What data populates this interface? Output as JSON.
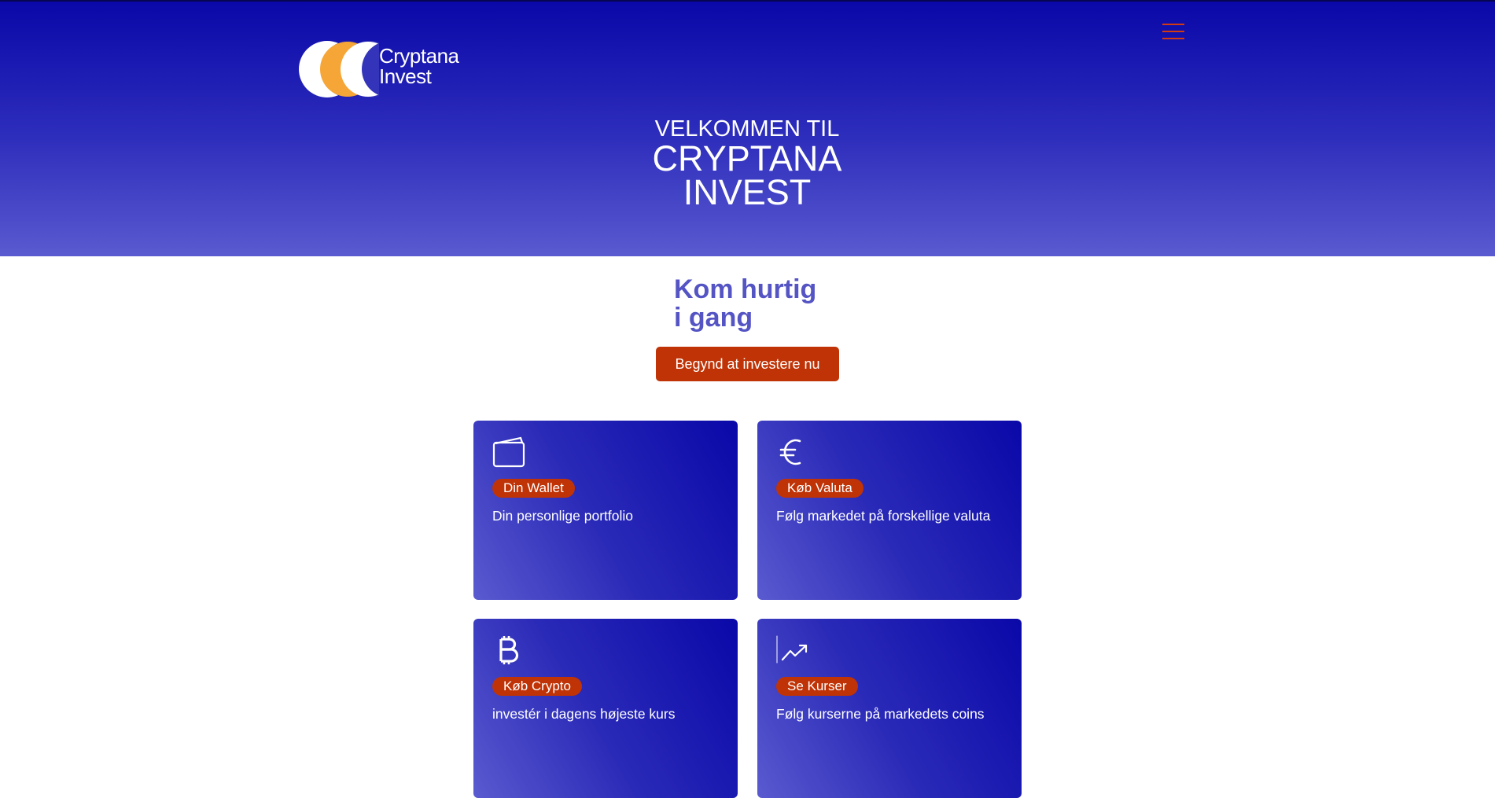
{
  "brand": {
    "logo_line1": "Cryptana",
    "logo_line2": "Invest",
    "colors": {
      "hero_top": "#0a08a8",
      "hero_bottom": "#5a5ad0",
      "accent": "#bf3306",
      "heading": "#5454c4"
    }
  },
  "header": {
    "menu_icon": "hamburger-menu-icon"
  },
  "hero": {
    "welcome": "VELKOMMEN TIL",
    "title_line1": "CRYPTANA",
    "title_line2": "INVEST"
  },
  "quickstart": {
    "title_line1": "Kom hurtig",
    "title_line2": "i gang",
    "cta_label": "Begynd at investere nu"
  },
  "cards": [
    {
      "icon": "wallet-icon",
      "badge": "Din Wallet",
      "description": "Din personlige portfolio"
    },
    {
      "icon": "euro-icon",
      "badge": "Køb Valuta",
      "description": "Følg markedet på forskellige valuta"
    },
    {
      "icon": "bitcoin-icon",
      "badge": "Køb Crypto",
      "description": "investér i dagens højeste kurs"
    },
    {
      "icon": "trending-up-icon",
      "badge": "Se Kurser",
      "description": "Følg kurserne på markedets coins"
    }
  ]
}
